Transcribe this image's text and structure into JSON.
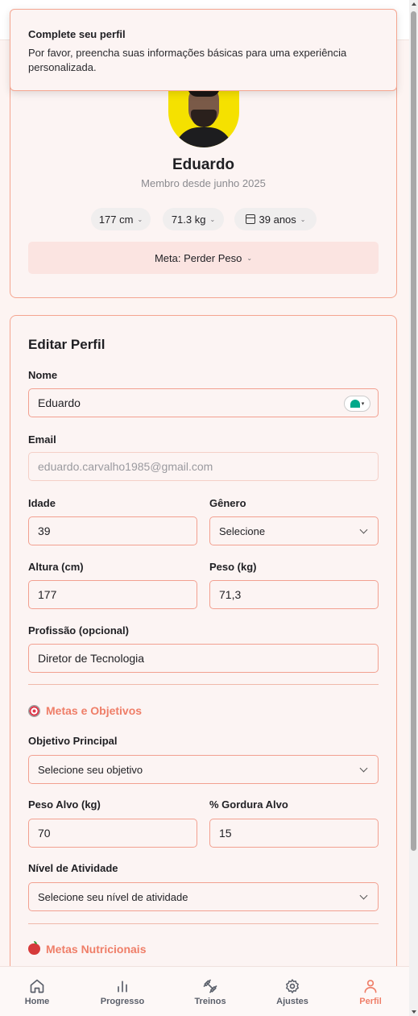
{
  "toast": {
    "title": "Complete seu perfil",
    "message": "Por favor, preencha suas informações básicas para uma experiência personalizada."
  },
  "profile": {
    "name": "Eduardo",
    "member_since": "Membro desde junho 2025",
    "height": "177 cm",
    "weight": "71.3 kg",
    "age": "39 anos",
    "goal": "Meta: Perder Peso"
  },
  "edit": {
    "title": "Editar Perfil",
    "name_label": "Nome",
    "name_value": "Eduardo",
    "email_label": "Email",
    "email_value": "eduardo.carvalho1985@gmail.com",
    "age_label": "Idade",
    "age_value": "39",
    "gender_label": "Gênero",
    "gender_value": "Selecione",
    "height_label": "Altura (cm)",
    "height_value": "177",
    "weight_label": "Peso (kg)",
    "weight_value": "71,3",
    "profession_label": "Profissão (opcional)",
    "profession_value": "Diretor de Tecnologia"
  },
  "goals": {
    "title": "Metas e Objetivos",
    "objective_label": "Objetivo Principal",
    "objective_value": "Selecione seu objetivo",
    "target_weight_label": "Peso Alvo (kg)",
    "target_weight_value": "70",
    "target_fat_label": "% Gordura Alvo",
    "target_fat_value": "15",
    "activity_label": "Nível de Atividade",
    "activity_value": "Selecione seu nível de atividade"
  },
  "nutrition": {
    "title": "Metas Nutricionais"
  },
  "nav": {
    "home": "Home",
    "progress": "Progresso",
    "workouts": "Treinos",
    "settings": "Ajustes",
    "profile": "Perfil",
    "active_color": "#ef7e68",
    "inactive_color": "#5a5f6a"
  },
  "colors": {
    "accent": "#ef7e68",
    "card_border": "#f4a590",
    "card_bg": "#fcf4f3"
  }
}
